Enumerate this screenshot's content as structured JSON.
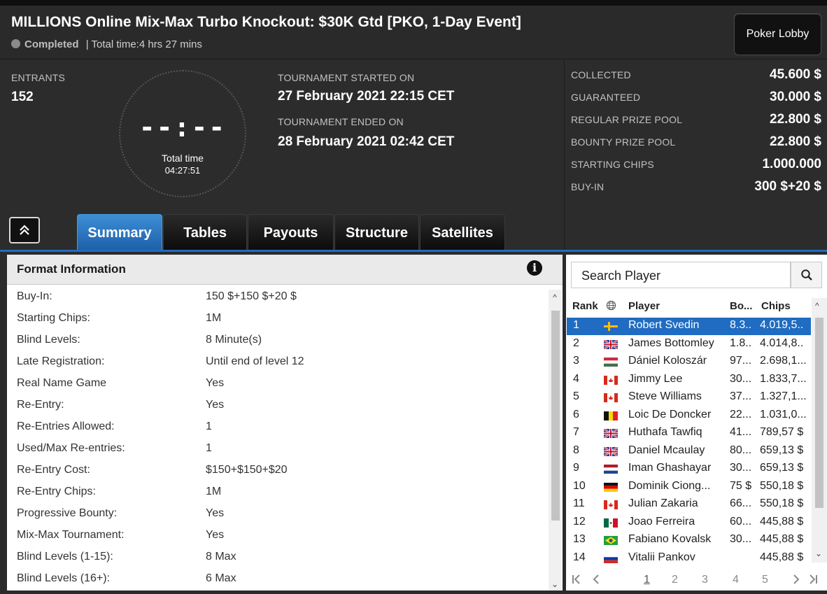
{
  "header": {
    "title": "MILLIONS Online Mix-Max Turbo Knockout: $30K Gtd [PKO, 1-Day Event]",
    "status": "Completed",
    "total_time": "| Total time:4 hrs  27 mins",
    "lobby_button": "Poker Lobby"
  },
  "info": {
    "entrants_label": "ENTRANTS",
    "entrants_value": "152",
    "clock_digits": "--:--",
    "clock_label": "Total time",
    "clock_value": "04:27:51",
    "started_label": "TOURNAMENT STARTED ON",
    "started_value": "27 February 2021  22:15 CET",
    "ended_label": "TOURNAMENT ENDED ON",
    "ended_value": "28 February 2021  02:42 CET"
  },
  "stats": [
    {
      "label": "COLLECTED",
      "value": "45.600 $"
    },
    {
      "label": "GUARANTEED",
      "value": "30.000 $"
    },
    {
      "label": "REGULAR PRIZE POOL",
      "value": "22.800 $"
    },
    {
      "label": "BOUNTY PRIZE POOL",
      "value": "22.800 $"
    },
    {
      "label": "STARTING CHIPS",
      "value": "1.000.000"
    },
    {
      "label": "BUY-IN",
      "value": "300 $+20 $"
    }
  ],
  "tabs": [
    "Summary",
    "Tables",
    "Payouts",
    "Structure",
    "Satellites"
  ],
  "format": {
    "title": "Format Information",
    "rows": [
      {
        "k": "Buy-In:",
        "v": "150 $+150 $+20 $"
      },
      {
        "k": "Starting Chips:",
        "v": "1M"
      },
      {
        "k": "Blind Levels:",
        "v": "8 Minute(s)"
      },
      {
        "k": "Late Registration:",
        "v": "Until end of level 12"
      },
      {
        "k": "Real Name Game",
        "v": "Yes"
      },
      {
        "k": "Re-Entry:",
        "v": "Yes"
      },
      {
        "k": "Re-Entries Allowed:",
        "v": "1"
      },
      {
        "k": "Used/Max Re-entries:",
        "v": "1"
      },
      {
        "k": "Re-Entry Cost:",
        "v": "$150+$150+$20"
      },
      {
        "k": "Re-Entry Chips:",
        "v": "1M"
      },
      {
        "k": "Progressive Bounty:",
        "v": "Yes"
      },
      {
        "k": "Mix-Max Tournament:",
        "v": "Yes"
      },
      {
        "k": "Blind Levels (1-15):",
        "v": "8 Max"
      },
      {
        "k": "Blind Levels (16+):",
        "v": "6 Max"
      }
    ]
  },
  "players": {
    "search_placeholder": "Search Player",
    "columns": {
      "rank": "Rank",
      "player": "Player",
      "bounty": "Bo...",
      "chips": "Chips"
    },
    "rows": [
      {
        "rank": "1",
        "flag": "se",
        "name": "Robert Svedin",
        "bounty": "8.3..",
        "chips": "4.019,5.."
      },
      {
        "rank": "2",
        "flag": "gb",
        "name": "James Bottomley",
        "bounty": "1.8..",
        "chips": "4.014,8.."
      },
      {
        "rank": "3",
        "flag": "hu",
        "name": "Dániel Koloszár",
        "bounty": "97...",
        "chips": "2.698,1..."
      },
      {
        "rank": "4",
        "flag": "ca",
        "name": "Jimmy Lee",
        "bounty": "30...",
        "chips": "1.833,7..."
      },
      {
        "rank": "5",
        "flag": "ca",
        "name": "Steve Williams",
        "bounty": "37...",
        "chips": "1.327,1..."
      },
      {
        "rank": "6",
        "flag": "be",
        "name": "Loic De Doncker",
        "bounty": "22...",
        "chips": "1.031,0..."
      },
      {
        "rank": "7",
        "flag": "gb",
        "name": "Huthafa Tawfiq",
        "bounty": "41...",
        "chips": "789,57 $"
      },
      {
        "rank": "8",
        "flag": "gb",
        "name": "Daniel Mcaulay",
        "bounty": "80...",
        "chips": "659,13 $"
      },
      {
        "rank": "9",
        "flag": "nl",
        "name": "Iman Ghashayar",
        "bounty": "30...",
        "chips": "659,13 $"
      },
      {
        "rank": "10",
        "flag": "de",
        "name": "Dominik Ciong...",
        "bounty": "75 $",
        "chips": "550,18 $"
      },
      {
        "rank": "11",
        "flag": "ca",
        "name": "Julian Zakaria",
        "bounty": "66...",
        "chips": "550,18 $"
      },
      {
        "rank": "12",
        "flag": "mx",
        "name": "Joao Ferreira",
        "bounty": "60...",
        "chips": "445,88 $"
      },
      {
        "rank": "13",
        "flag": "br",
        "name": "Fabiano Kovalsk",
        "bounty": "30...",
        "chips": "445,88 $"
      },
      {
        "rank": "14",
        "flag": "ru",
        "name": "Vitalii Pankov",
        "bounty": "",
        "chips": "445,88 $"
      }
    ],
    "pages": [
      "1",
      "2",
      "3",
      "4",
      "5"
    ]
  },
  "colors": {
    "accent": "#1f6cc2",
    "background": "#2b2b2b"
  }
}
